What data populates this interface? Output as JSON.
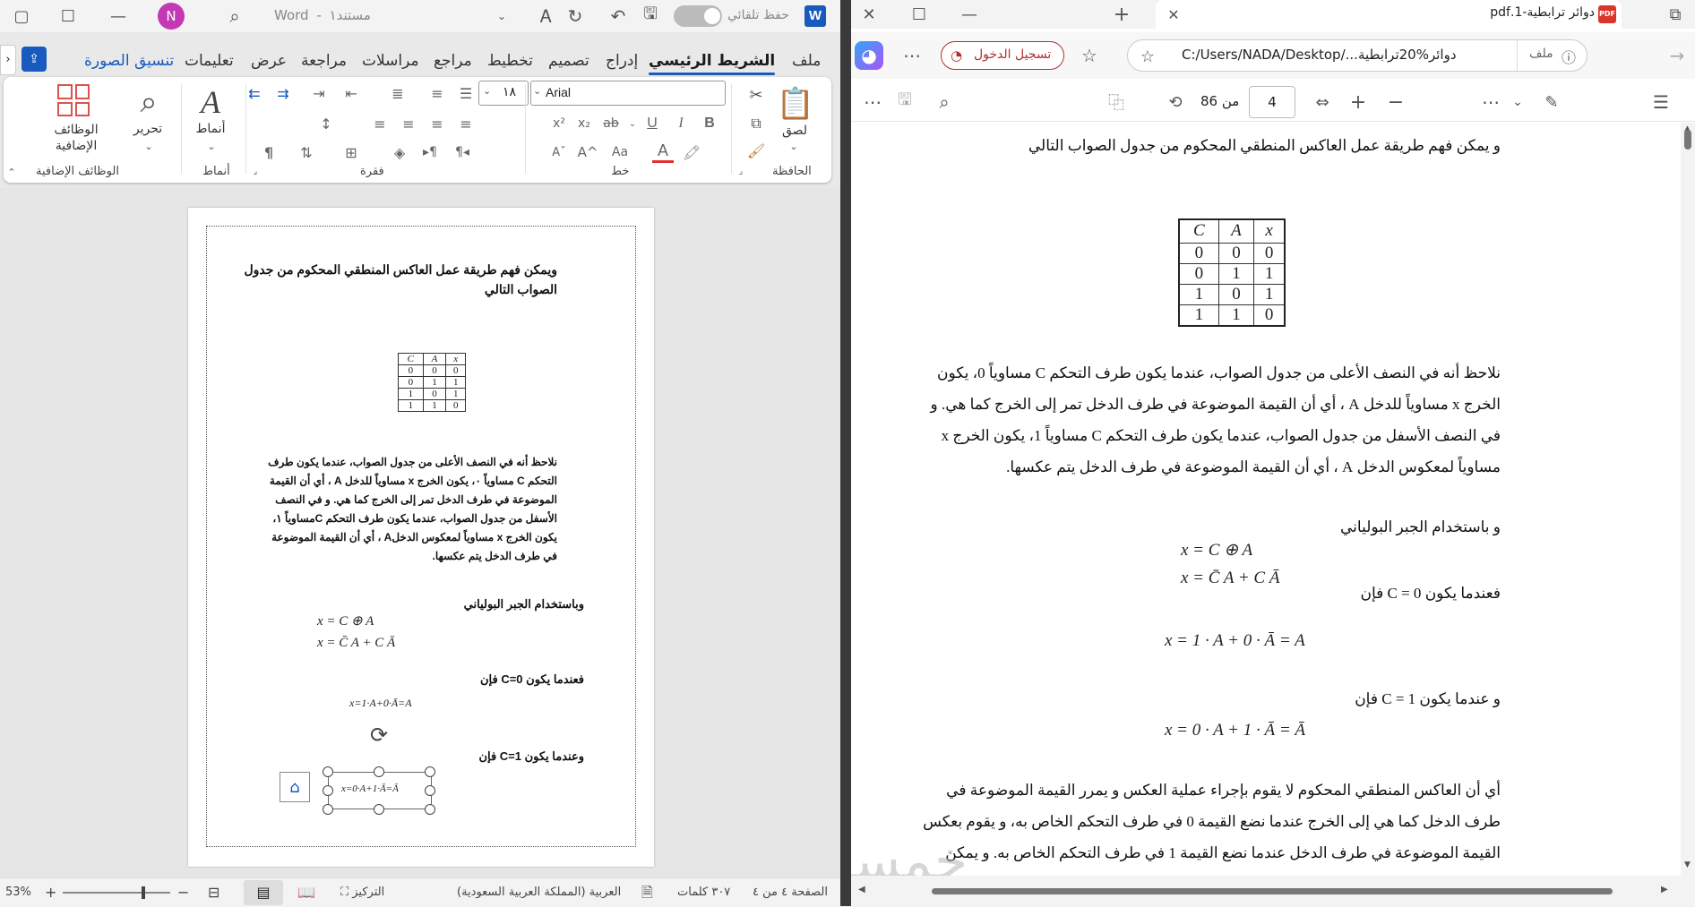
{
  "word": {
    "title_doc": "مستند١",
    "title_sep": "-",
    "title_app": "Word",
    "autosave_label": "حفظ تلقائي",
    "avatar": "N",
    "tabs": [
      "ملف",
      "الشريط الرئيسي",
      "إدراج",
      "تصميم",
      "تخطيط",
      "مراجع",
      "مراسلات",
      "مراجعة",
      "عرض",
      "تعليمات",
      "تنسيق الصورة"
    ],
    "ribbon": {
      "paste": "لصق",
      "clipboard": "الحافظة",
      "font_name": "Arial",
      "font_size": "١٨",
      "font_group": "خط",
      "paragraph_group": "فقرة",
      "styles": "أنماط",
      "styles_group": "أنماط",
      "editing": "تحرير",
      "addins": "الوظائف الإضافية",
      "addins_group": "الوظائف الإضافية",
      "bold": "B",
      "italic": "I",
      "underline": "U",
      "strike": "ab",
      "sub": "x₂",
      "sup": "x²",
      "fontcolor": "A",
      "changecase": "Aa",
      "pilcrow": "¶"
    },
    "doc": {
      "heading": "ويمكن فهم طريقة عمل العاكس المنطقي المحكوم من جدول الصواب التالي",
      "table": {
        "headers": [
          "C",
          "A",
          "x"
        ],
        "rows": [
          [
            "0",
            "0",
            "0"
          ],
          [
            "0",
            "1",
            "1"
          ],
          [
            "1",
            "0",
            "1"
          ],
          [
            "1",
            "1",
            "0"
          ]
        ]
      },
      "para1": "نلاحظ أنه في النصف الأعلى من جدول الصواب، عندما يكون طرف التحكم C مساوياً ٠، يكون الخرج x مساوياً للدخل A ، أي أن القيمة الموضوعة في طرف الدخل تمر إلى الخرج كما هي. و في النصف الأسفل من جدول الصواب، عندما يكون طرف التحكم Cمساوياً ١، يكون الخرج x مساوياً لمعكوس الدخلA ، أي أن القيمة الموضوعة في طرف الدخل يتم عكسها.",
      "boolean": "وباستخدام الجبر البولياني",
      "eq1": "x = C ⊕ A",
      "eq2": "x = C̄ A + C Ā",
      "when0": "فعندما يكون C=0 فإن",
      "eq3": "x=1·A+0·Ā=A",
      "when1": "وعندما يكون C=1 فإن",
      "eq4": "x=0·A+1·Ā=Ā"
    },
    "status": {
      "page": "الصفحة ٤ من ٤",
      "words": "٣٠٧ كلمات",
      "lang": "العربية (المملكة العربية السعودية)",
      "focus": "التركيز",
      "zoom": "53%"
    }
  },
  "edge": {
    "tab_title": "دوائر ترابطية-1.pdf",
    "file_label": "ملف",
    "url": "C:/Users/NADA/Desktop/...دوائر%20ترابطية",
    "signin": "تسجيل الدخول",
    "page_current": "4",
    "page_of": "من 86",
    "pdf": {
      "intro": "و يمكن فهم طريقة عمل العاكس المنطقي المحكوم من جدول الصواب التالي",
      "table": {
        "headers": [
          "C",
          "A",
          "x"
        ],
        "rows": [
          [
            "0",
            "0",
            "0"
          ],
          [
            "0",
            "1",
            "1"
          ],
          [
            "1",
            "0",
            "1"
          ],
          [
            "1",
            "1",
            "0"
          ]
        ]
      },
      "p1": "نلاحظ أنه في النصف الأعلى من جدول الصواب، عندما يكون طرف التحكم C مساوياً 0، يكون الخرج x مساوياً للدخل A ، أي أن القيمة الموضوعة في طرف الدخل تمر إلى الخرج كما هي. و في النصف الأسفل من جدول الصواب، عندما يكون طرف التحكم C مساوياً 1، يكون الخرج x مساوياً لمعكوس الدخل A ، أي أن القيمة الموضوعة في طرف الدخل يتم عكسها.",
      "boolean": "و باستخدام الجبر البولياني",
      "eq1": "x = C ⊕ A",
      "eq2": "x = C̄ A + C Ā",
      "when0": "فعندما يكون C = 0 فإن",
      "eq3": "x = 1 · A + 0 · Ā = A",
      "when1": "و عندما يكون C = 1 فإن",
      "eq4": "x = 0 · A + 1 · Ā = Ā",
      "p2": "أي أن العاكس المنطقي المحكوم لا يقوم بإجراء عملية العكس و يمرر القيمة الموضوعة في طرف الدخل كما هي إلى الخرج عندما نضع القيمة 0 في طرف التحكم الخاص به، و يقوم بعكس القيمة الموضوعة في طرف الدخل عندما نضع القيمة 1 في طرف التحكم الخاص به. و يمكن تلخيص ذلك في جدول الصواب التالي"
    }
  },
  "watermark": "خمسات"
}
